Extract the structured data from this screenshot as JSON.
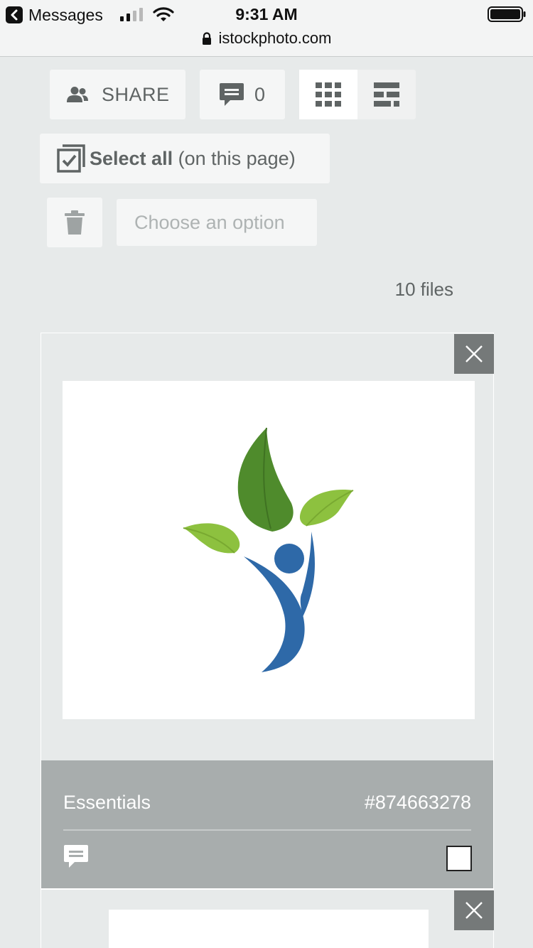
{
  "status_bar": {
    "back_app": "Messages",
    "time": "9:31 AM",
    "url": "istockphoto.com"
  },
  "toolbar": {
    "share_label": "SHARE",
    "comment_count": "0",
    "view_modes": [
      "grid",
      "mosaic"
    ],
    "active_view": "grid"
  },
  "selection": {
    "select_all_bold": "Select all",
    "select_all_suffix": "(on this page)",
    "action_placeholder": "Choose an option"
  },
  "file_count": "10 files",
  "files": [
    {
      "collection": "Essentials",
      "id": "#874663278",
      "checked": false,
      "thumbnail": "leaf-person-logo"
    },
    {
      "collection": "",
      "id": "",
      "checked": false,
      "thumbnail": "blank"
    }
  ],
  "colors": {
    "background": "#e7eaea",
    "button": "#f5f6f6",
    "card_footer": "#a8adad",
    "close_button": "#757979",
    "leaf_dark": "#4f8b2c",
    "leaf_light": "#8dc13f",
    "figure_blue": "#2e69a8"
  },
  "icons": [
    "back-arrow-icon",
    "signal-icon",
    "wifi-icon",
    "battery-icon",
    "lock-icon",
    "people-icon",
    "comment-icon",
    "grid-view-icon",
    "mosaic-view-icon",
    "select-all-icon",
    "trash-icon",
    "close-icon"
  ]
}
